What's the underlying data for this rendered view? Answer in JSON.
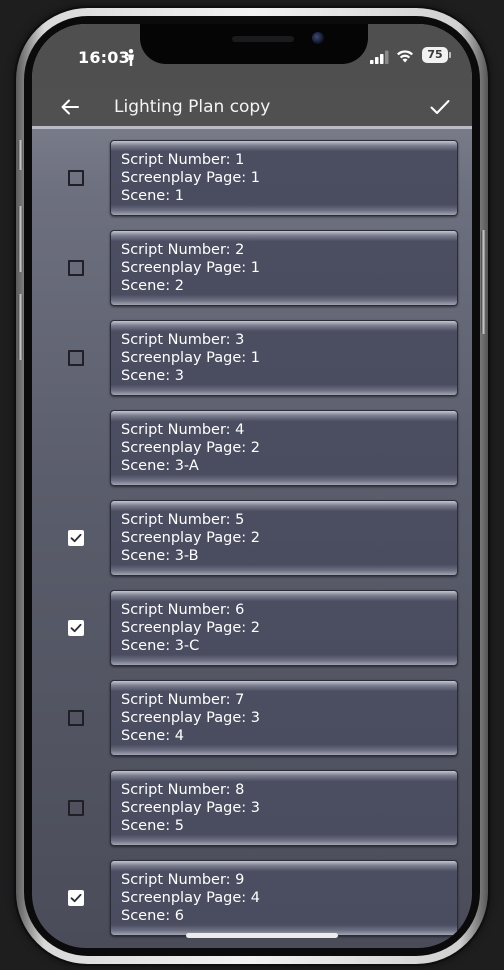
{
  "status_bar": {
    "time": "16:03",
    "battery": "75",
    "icons": [
      "person-icon",
      "signal-icon",
      "wifi-icon",
      "battery-icon"
    ]
  },
  "app_bar": {
    "title": "Lighting Plan copy",
    "back_icon": "arrow-left-icon",
    "confirm_icon": "checkmark-icon"
  },
  "field_labels": {
    "script": "Script Number: ",
    "page": "Screenplay Page: ",
    "scene": "Scene: "
  },
  "scenes": [
    {
      "script_number": "1",
      "screenplay_page": "1",
      "scene": "1",
      "checked": false,
      "has_checkbox": true
    },
    {
      "script_number": "2",
      "screenplay_page": "1",
      "scene": "2",
      "checked": false,
      "has_checkbox": true
    },
    {
      "script_number": "3",
      "screenplay_page": "1",
      "scene": "3",
      "checked": false,
      "has_checkbox": true
    },
    {
      "script_number": "4",
      "screenplay_page": "2",
      "scene": "3-A",
      "checked": false,
      "has_checkbox": false
    },
    {
      "script_number": "5",
      "screenplay_page": "2",
      "scene": "3-B",
      "checked": true,
      "has_checkbox": true
    },
    {
      "script_number": "6",
      "screenplay_page": "2",
      "scene": "3-C",
      "checked": true,
      "has_checkbox": true
    },
    {
      "script_number": "7",
      "screenplay_page": "3",
      "scene": "4",
      "checked": false,
      "has_checkbox": true
    },
    {
      "script_number": "8",
      "screenplay_page": "3",
      "scene": "5",
      "checked": false,
      "has_checkbox": true
    },
    {
      "script_number": "9",
      "screenplay_page": "4",
      "scene": "6",
      "checked": true,
      "has_checkbox": true
    }
  ],
  "colors": {
    "app_bar": "#505051",
    "card": "#4a4d60",
    "text": "#ffffff"
  }
}
